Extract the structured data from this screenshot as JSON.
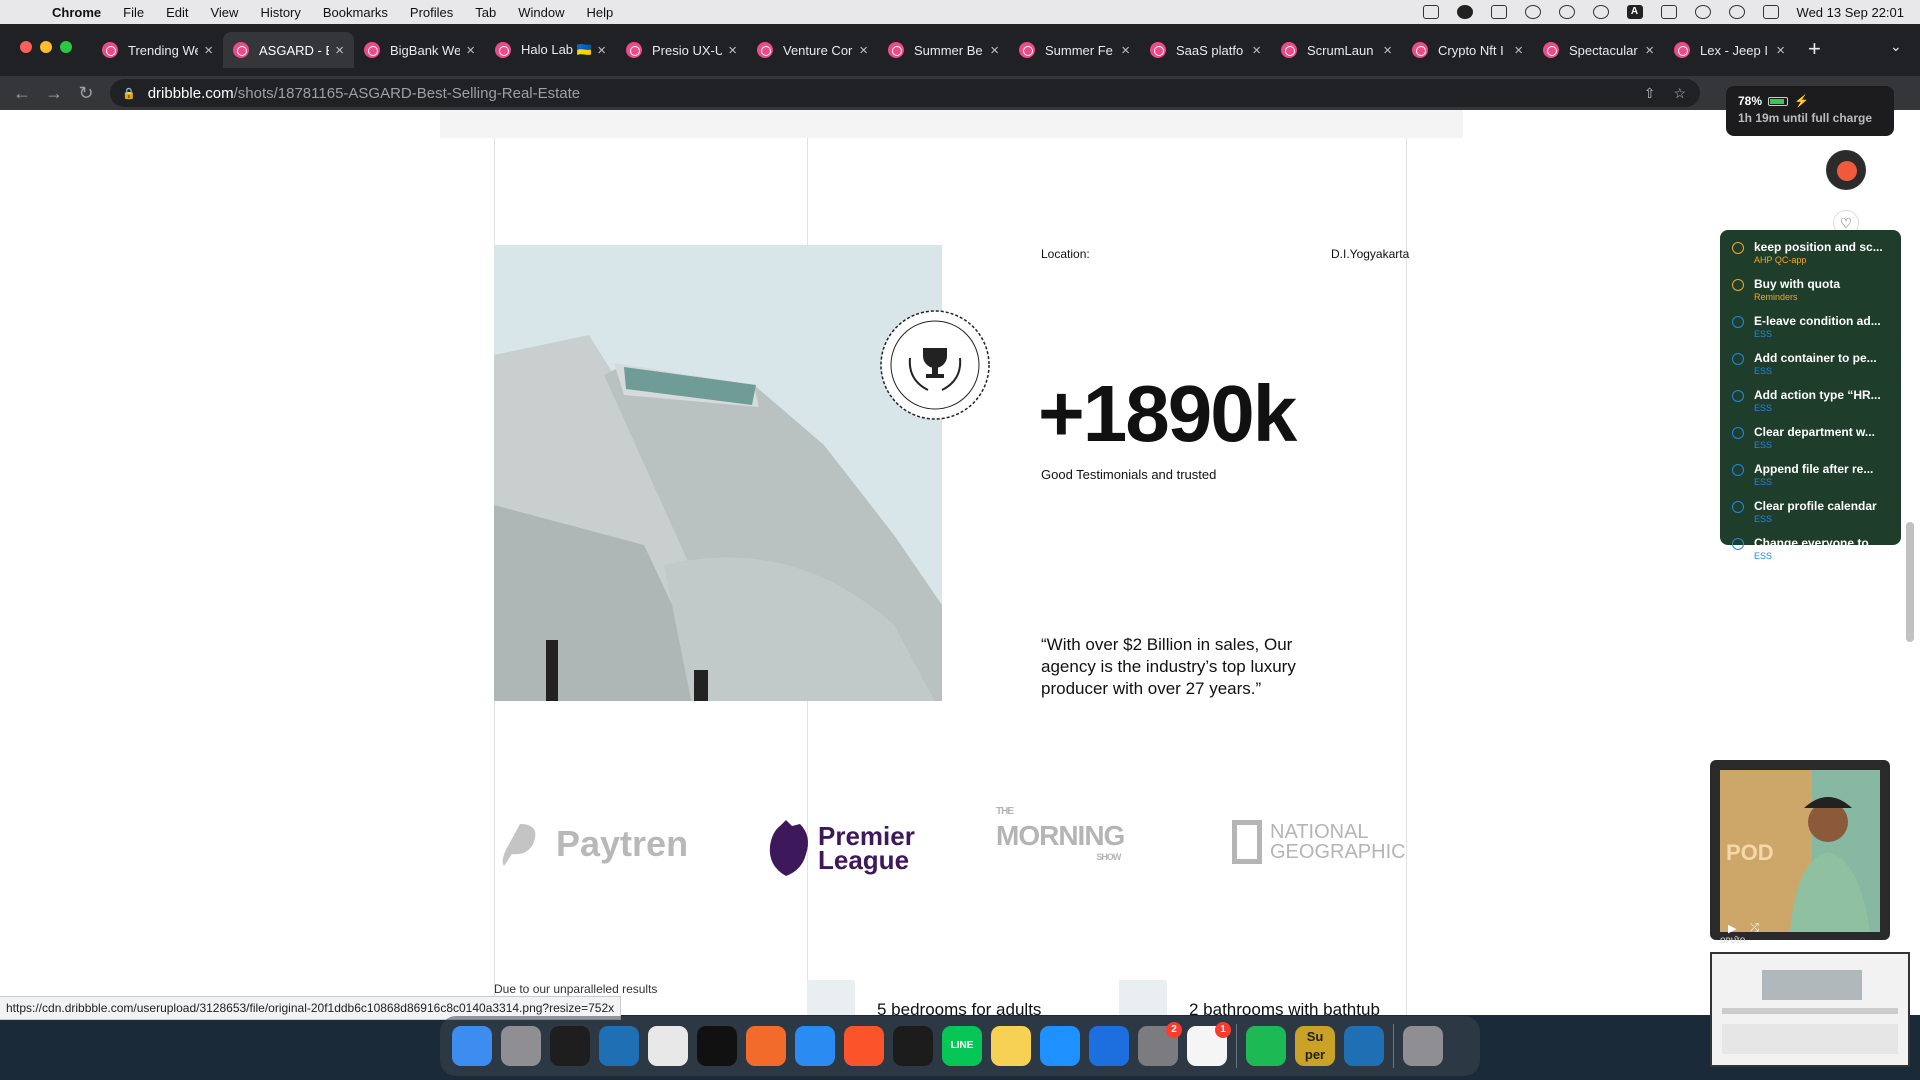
{
  "menubar": {
    "app": "Chrome",
    "menus": [
      "File",
      "Edit",
      "View",
      "History",
      "Bookmarks",
      "Profiles",
      "Tab",
      "Window",
      "Help"
    ],
    "input_source": "A",
    "clock": "Wed 13 Sep  22:01"
  },
  "tabs": [
    {
      "title": "Trending We"
    },
    {
      "title": "ASGARD - E",
      "active": true
    },
    {
      "title": "BigBank We"
    },
    {
      "title": "Halo Lab 🇺🇦"
    },
    {
      "title": "Presio UX-U"
    },
    {
      "title": "Venture Cor"
    },
    {
      "title": "Summer Be"
    },
    {
      "title": "Summer Fe"
    },
    {
      "title": "SaaS platfo"
    },
    {
      "title": "ScrumLaun"
    },
    {
      "title": "Crypto Nft I"
    },
    {
      "title": "Spectacular"
    },
    {
      "title": "Lex - Jeep I"
    }
  ],
  "address": {
    "host": "dribbble.com",
    "path": "/shots/18781165-ASGARD-Best-Selling-Real-Estate"
  },
  "battery": {
    "percent": "78%",
    "remaining": "1h 19m until full charge"
  },
  "content": {
    "location_label": "Location:",
    "location_value": "D.I.Yogyakarta",
    "big_number": "+1890k",
    "big_number_caption": "Good Testimonials and trusted",
    "quote": "“With over $2 Billion in sales, Our agency is the industry’s top luxury producer with over 27 years.”",
    "logos": {
      "paytren": "Paytren",
      "premier_1": "Premier",
      "premier_2": "League",
      "morning_1": "THE",
      "morning_2": "MORNING",
      "morning_3": "SHOW",
      "natgeo_1": "NATIONAL",
      "natgeo_2": "GEOGRAPHIC"
    },
    "due_text": "Due to our unparalleled results",
    "feature_1": "5 bedrooms for adults",
    "feature_2": "2 bathrooms with bathtub"
  },
  "reminders": [
    {
      "title": "keep position and sc...",
      "list": "AHP QC-app",
      "color": "#f5a623"
    },
    {
      "title": "Buy with quota",
      "list": "Reminders",
      "color": "#f5a623"
    },
    {
      "title": "E-leave condition ad...",
      "list": "ESS",
      "color": "#1e88e5"
    },
    {
      "title": "Add container to pe...",
      "list": "ESS",
      "color": "#1e88e5"
    },
    {
      "title": "Add action type “HR...",
      "list": "ESS",
      "color": "#1e88e5"
    },
    {
      "title": "Clear department w...",
      "list": "ESS",
      "color": "#1e88e5"
    },
    {
      "title": "Append file after re...",
      "list": "ESS",
      "color": "#1e88e5"
    },
    {
      "title": "Clear profile calendar",
      "list": "ESS",
      "color": "#1e88e5"
    },
    {
      "title": "Change everyone to...",
      "list": "ESS",
      "color": "#1e88e5"
    }
  ],
  "status_url": "https://cdn.dribbble.com/userupload/3128653/file/original-20f1ddb6c10868d86916c8c0140a3314.png?resize=752x",
  "video": {
    "channel_text": "POD",
    "caption": "ᴏᴘᴜ̄ɪᴏ"
  },
  "dock": {
    "apps": [
      {
        "name": "finder",
        "color": "#3d8cf0"
      },
      {
        "name": "launchpad",
        "color": "#8e8e93"
      },
      {
        "name": "figma",
        "color": "#1e1e1e"
      },
      {
        "name": "vscode",
        "color": "#1f6fb5"
      },
      {
        "name": "chrome",
        "color": "#e8e8e8"
      },
      {
        "name": "terminal",
        "color": "#111111"
      },
      {
        "name": "pencil",
        "color": "#f26b2a"
      },
      {
        "name": "safari",
        "color": "#2a8bf2"
      },
      {
        "name": "brave",
        "color": "#fb542b"
      },
      {
        "name": "activity-monitor",
        "color": "#1c1c1c"
      },
      {
        "name": "line",
        "color": "#06c755",
        "label": "LINE"
      },
      {
        "name": "notes",
        "color": "#f7d154"
      },
      {
        "name": "app-store",
        "color": "#1e90ff"
      },
      {
        "name": "xcode",
        "color": "#1d6fe0"
      },
      {
        "name": "system-preferences",
        "color": "#7b7b80",
        "badge": "2"
      },
      {
        "name": "reminders",
        "color": "#f5f5f5",
        "badge": "1"
      },
      {
        "name": "spotify",
        "color": "#1db954"
      },
      {
        "name": "super",
        "color": "#c9a227",
        "label": "Su per"
      },
      {
        "name": "vscode-2",
        "color": "#1f6fb5"
      },
      {
        "name": "trash",
        "color": "#8e8e93"
      }
    ]
  }
}
